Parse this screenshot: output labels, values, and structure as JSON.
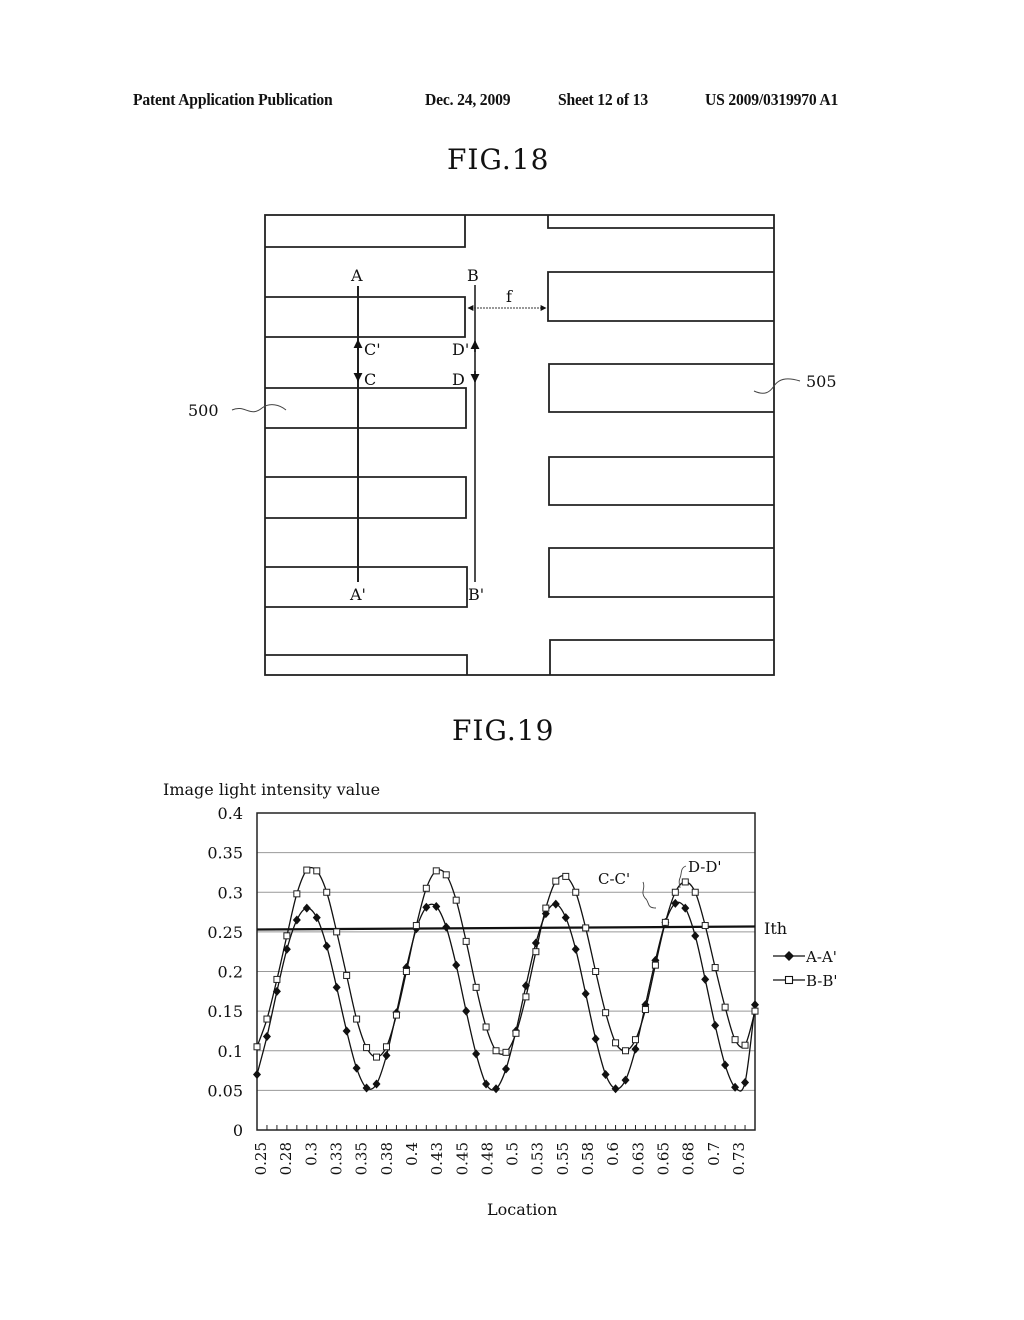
{
  "header": {
    "publication": "Patent Application Publication",
    "date": "Dec. 24, 2009",
    "sheet": "Sheet 12 of 13",
    "number": "US 2009/0319970 A1"
  },
  "fig18": {
    "title": "FIG.18",
    "labels": {
      "a": "A",
      "a_prime": "A'",
      "b": "B",
      "b_prime": "B'",
      "c": "C",
      "c_prime": "C'",
      "d": "D",
      "d_prime": "D'",
      "f": "f",
      "ref_left": "500",
      "ref_right": "505"
    }
  },
  "fig19": {
    "title": "FIG.19",
    "annotations": {
      "cc": "C-C'",
      "dd": "D-D'",
      "ith": "Ith"
    }
  },
  "chart_data": {
    "type": "line",
    "title": "FIG.19",
    "ylabel": "Image light intensity value",
    "xlabel": "Location",
    "ylim": [
      0,
      0.4
    ],
    "xlim": [
      0.25,
      0.75
    ],
    "yticks": [
      "0",
      "0.05",
      "0.1",
      "0.15",
      "0.2",
      "0.25",
      "0.3",
      "0.35",
      "0.4"
    ],
    "xticks": [
      "0.25",
      "0.28",
      "0.3",
      "0.33",
      "0.35",
      "0.38",
      "0.4",
      "0.43",
      "0.45",
      "0.48",
      "0.5",
      "0.53",
      "0.55",
      "0.58",
      "0.6",
      "0.63",
      "0.65",
      "0.68",
      "0.7",
      "0.73"
    ],
    "grid": true,
    "legend": "right",
    "threshold": {
      "name": "Ith",
      "value": 0.253
    },
    "x": [
      0.25,
      0.26,
      0.27,
      0.28,
      0.29,
      0.3,
      0.31,
      0.32,
      0.33,
      0.34,
      0.35,
      0.36,
      0.37,
      0.38,
      0.39,
      0.4,
      0.41,
      0.42,
      0.43,
      0.44,
      0.45,
      0.46,
      0.47,
      0.48,
      0.49,
      0.5,
      0.51,
      0.52,
      0.53,
      0.54,
      0.55,
      0.56,
      0.57,
      0.58,
      0.59,
      0.6,
      0.61,
      0.62,
      0.63,
      0.64,
      0.65,
      0.66,
      0.67,
      0.68,
      0.69,
      0.7,
      0.71,
      0.72,
      0.73,
      0.74,
      0.75
    ],
    "series": [
      {
        "name": "A-A'",
        "marker": "filled-diamond",
        "values": [
          0.07,
          0.118,
          0.175,
          0.228,
          0.265,
          0.28,
          0.268,
          0.232,
          0.18,
          0.125,
          0.078,
          0.053,
          0.058,
          0.094,
          0.148,
          0.205,
          0.254,
          0.281,
          0.282,
          0.256,
          0.208,
          0.15,
          0.096,
          0.058,
          0.052,
          0.077,
          0.125,
          0.182,
          0.236,
          0.273,
          0.285,
          0.268,
          0.228,
          0.172,
          0.115,
          0.07,
          0.052,
          0.063,
          0.102,
          0.158,
          0.214,
          0.262,
          0.286,
          0.28,
          0.245,
          0.19,
          0.132,
          0.082,
          0.054,
          0.06,
          0.158
        ]
      },
      {
        "name": "B-B'",
        "marker": "open-square",
        "values": [
          0.105,
          0.14,
          0.19,
          0.245,
          0.298,
          0.328,
          0.327,
          0.3,
          0.25,
          0.195,
          0.14,
          0.104,
          0.092,
          0.105,
          0.145,
          0.2,
          0.258,
          0.305,
          0.327,
          0.322,
          0.29,
          0.238,
          0.18,
          0.13,
          0.1,
          0.098,
          0.122,
          0.168,
          0.225,
          0.28,
          0.314,
          0.32,
          0.3,
          0.255,
          0.2,
          0.148,
          0.11,
          0.1,
          0.114,
          0.152,
          0.208,
          0.262,
          0.3,
          0.313,
          0.3,
          0.258,
          0.205,
          0.155,
          0.114,
          0.107,
          0.15
        ]
      }
    ]
  }
}
